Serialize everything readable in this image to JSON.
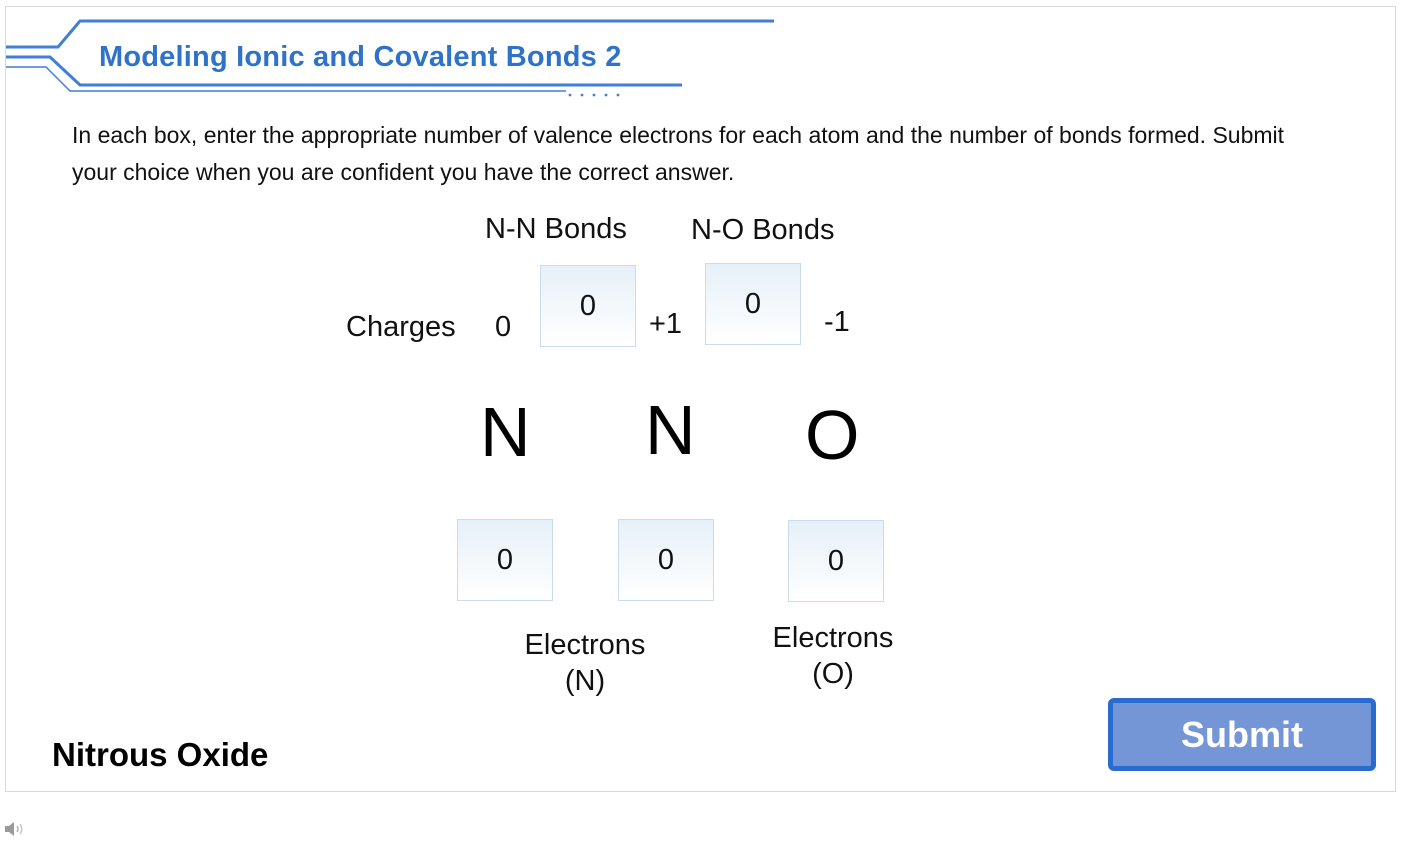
{
  "header": {
    "title": "Modeling Ionic and Covalent Bonds 2"
  },
  "instructions": "In each box, enter the appropriate number of valence electrons for each atom and the number of bonds formed. Submit your choice when you are confident you have the correct answer.",
  "bond_labels": {
    "nn": "N-N Bonds",
    "no": "N-O Bonds"
  },
  "charges": {
    "label": "Charges",
    "n1": "0",
    "n2": "+1",
    "o": "-1"
  },
  "atoms": {
    "n1": "N",
    "n2": "N",
    "o": "O"
  },
  "inputs": {
    "nn_bonds": "0",
    "no_bonds": "0",
    "electrons_n1": "0",
    "electrons_n2": "0",
    "electrons_o": "0"
  },
  "electron_labels": {
    "n_line1": "Electrons",
    "n_line2": "(N)",
    "o_line1": "Electrons",
    "o_line2": "(O)"
  },
  "compound_name": "Nitrous Oxide",
  "submit_label": "Submit",
  "colors": {
    "title": "#2f73c9",
    "accent_line": "#3f7fd6",
    "submit_fill": "#7496d6",
    "submit_border": "#2a6bd0",
    "input_box": "#e6f0f8"
  },
  "icons": {
    "audio": "speaker-icon"
  }
}
